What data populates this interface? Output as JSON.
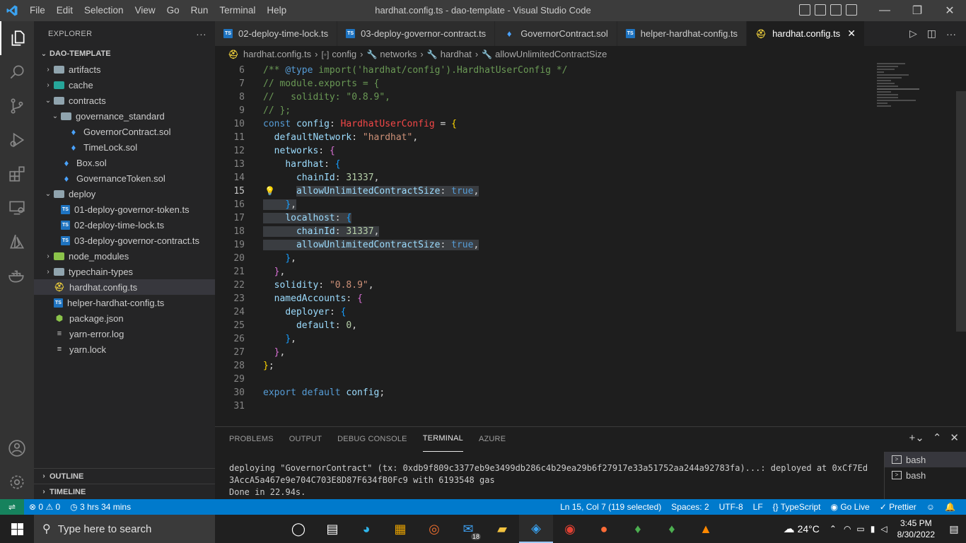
{
  "window": {
    "title": "hardhat.config.ts - dao-template - Visual Studio Code",
    "menu": [
      "File",
      "Edit",
      "Selection",
      "View",
      "Go",
      "Run",
      "Terminal",
      "Help"
    ]
  },
  "sidebar": {
    "header": "EXPLORER",
    "more": "···",
    "root": "DAO-TEMPLATE",
    "tree": [
      {
        "label": "artifacts",
        "kind": "folder",
        "depth": 0,
        "expanded": false
      },
      {
        "label": "cache",
        "kind": "folder-cache",
        "depth": 0,
        "expanded": false
      },
      {
        "label": "contracts",
        "kind": "folder",
        "depth": 0,
        "expanded": true
      },
      {
        "label": "governance_standard",
        "kind": "folder",
        "depth": 1,
        "expanded": true
      },
      {
        "label": "GovernorContract.sol",
        "kind": "sol",
        "depth": 2
      },
      {
        "label": "TimeLock.sol",
        "kind": "sol",
        "depth": 2
      },
      {
        "label": "Box.sol",
        "kind": "sol",
        "depth": 1
      },
      {
        "label": "GovernanceToken.sol",
        "kind": "sol",
        "depth": 1
      },
      {
        "label": "deploy",
        "kind": "folder",
        "depth": 0,
        "expanded": true
      },
      {
        "label": "01-deploy-governor-token.ts",
        "kind": "ts",
        "depth": 1
      },
      {
        "label": "02-deploy-time-lock.ts",
        "kind": "ts",
        "depth": 1
      },
      {
        "label": "03-deploy-governor-contract.ts",
        "kind": "ts",
        "depth": 1
      },
      {
        "label": "node_modules",
        "kind": "folder-node",
        "depth": 0,
        "expanded": false
      },
      {
        "label": "typechain-types",
        "kind": "folder",
        "depth": 0,
        "expanded": false
      },
      {
        "label": "hardhat.config.ts",
        "kind": "hh",
        "depth": 0,
        "selected": true
      },
      {
        "label": "helper-hardhat-config.ts",
        "kind": "ts",
        "depth": 0
      },
      {
        "label": "package.json",
        "kind": "json",
        "depth": 0
      },
      {
        "label": "yarn-error.log",
        "kind": "log",
        "depth": 0
      },
      {
        "label": "yarn.lock",
        "kind": "log",
        "depth": 0
      }
    ],
    "outline": "OUTLINE",
    "timeline": "TIMELINE"
  },
  "tabs": [
    {
      "label": "02-deploy-time-lock.ts",
      "kind": "ts"
    },
    {
      "label": "03-deploy-governor-contract.ts",
      "kind": "ts"
    },
    {
      "label": "GovernorContract.sol",
      "kind": "sol"
    },
    {
      "label": "helper-hardhat-config.ts",
      "kind": "ts"
    },
    {
      "label": "hardhat.config.ts",
      "kind": "hh",
      "active": true
    }
  ],
  "breadcrumb": [
    "hardhat.config.ts",
    "config",
    "networks",
    "hardhat",
    "allowUnlimitedContractSize"
  ],
  "editor": {
    "lines": [
      {
        "n": "6",
        "tokens": [
          [
            "c-com",
            "/** "
          ],
          [
            "c-ann",
            "@type"
          ],
          [
            "c-com",
            " import('hardhat/config').HardhatUserConfig */"
          ]
        ]
      },
      {
        "n": "7",
        "tokens": [
          [
            "c-com",
            "// module.exports = {"
          ]
        ]
      },
      {
        "n": "8",
        "tokens": [
          [
            "c-com",
            "//   solidity: \"0.8.9\","
          ]
        ]
      },
      {
        "n": "9",
        "tokens": [
          [
            "c-com",
            "// };"
          ]
        ]
      },
      {
        "n": "10",
        "tokens": [
          [
            "c-kw",
            "const "
          ],
          [
            "c-var",
            "config"
          ],
          [
            "c-punc",
            ": "
          ],
          [
            "c-type",
            "HardhatUserConfig"
          ],
          [
            "c-punc",
            " = "
          ],
          [
            "c-b1",
            "{"
          ]
        ]
      },
      {
        "n": "11",
        "tokens": [
          [
            "c-punc",
            "  "
          ],
          [
            "c-var",
            "defaultNetwork"
          ],
          [
            "c-punc",
            ": "
          ],
          [
            "c-str",
            "\"hardhat\""
          ],
          [
            "c-punc",
            ","
          ]
        ]
      },
      {
        "n": "12",
        "tokens": [
          [
            "c-punc",
            "  "
          ],
          [
            "c-var",
            "networks"
          ],
          [
            "c-punc",
            ": "
          ],
          [
            "c-b2",
            "{"
          ]
        ]
      },
      {
        "n": "13",
        "tokens": [
          [
            "c-punc",
            "    "
          ],
          [
            "c-var",
            "hardhat"
          ],
          [
            "c-punc",
            ": "
          ],
          [
            "c-b3",
            "{"
          ]
        ]
      },
      {
        "n": "14",
        "tokens": [
          [
            "c-punc",
            "      "
          ],
          [
            "c-var",
            "chainId"
          ],
          [
            "c-punc",
            ": "
          ],
          [
            "c-num",
            "31337"
          ],
          [
            "c-punc",
            ","
          ]
        ]
      },
      {
        "n": "15",
        "tokens": [
          [
            "c-punc",
            "      "
          ],
          [
            "sel c-var",
            "allowUnlimitedContractSize"
          ],
          [
            "sel c-punc",
            ": "
          ],
          [
            "sel c-bool",
            "true"
          ],
          [
            "sel c-punc",
            ","
          ]
        ],
        "current": true,
        "bulb": true
      },
      {
        "n": "16",
        "tokens": [
          [
            "sel c-punc",
            "    "
          ],
          [
            "sel c-b3",
            "}"
          ],
          [
            "sel c-punc",
            ","
          ]
        ]
      },
      {
        "n": "17",
        "tokens": [
          [
            "sel c-punc",
            "    "
          ],
          [
            "sel c-var",
            "localhost"
          ],
          [
            "sel c-punc",
            ": "
          ],
          [
            "sel c-b3",
            "{"
          ]
        ]
      },
      {
        "n": "18",
        "tokens": [
          [
            "sel c-punc",
            "      "
          ],
          [
            "sel c-var",
            "chainId"
          ],
          [
            "sel c-punc",
            ": "
          ],
          [
            "sel c-num",
            "31337"
          ],
          [
            "sel c-punc",
            ","
          ]
        ]
      },
      {
        "n": "19",
        "tokens": [
          [
            "sel c-punc",
            "      "
          ],
          [
            "sel c-var",
            "allowUnlimitedContractSize"
          ],
          [
            "sel c-punc",
            ": "
          ],
          [
            "sel c-bool",
            "true"
          ],
          [
            "sel c-punc",
            ","
          ]
        ]
      },
      {
        "n": "20",
        "tokens": [
          [
            "c-punc",
            "    "
          ],
          [
            "c-b3",
            "}"
          ],
          [
            "c-punc",
            ","
          ]
        ]
      },
      {
        "n": "21",
        "tokens": [
          [
            "c-punc",
            "  "
          ],
          [
            "c-b2",
            "}"
          ],
          [
            "c-punc",
            ","
          ]
        ]
      },
      {
        "n": "22",
        "tokens": [
          [
            "c-punc",
            "  "
          ],
          [
            "c-var",
            "solidity"
          ],
          [
            "c-punc",
            ": "
          ],
          [
            "c-str",
            "\"0.8.9\""
          ],
          [
            "c-punc",
            ","
          ]
        ]
      },
      {
        "n": "23",
        "tokens": [
          [
            "c-punc",
            "  "
          ],
          [
            "c-var",
            "namedAccounts"
          ],
          [
            "c-punc",
            ": "
          ],
          [
            "c-b2",
            "{"
          ]
        ]
      },
      {
        "n": "24",
        "tokens": [
          [
            "c-punc",
            "    "
          ],
          [
            "c-var",
            "deployer"
          ],
          [
            "c-punc",
            ": "
          ],
          [
            "c-b3",
            "{"
          ]
        ]
      },
      {
        "n": "25",
        "tokens": [
          [
            "c-punc",
            "      "
          ],
          [
            "c-var",
            "default"
          ],
          [
            "c-punc",
            ": "
          ],
          [
            "c-num",
            "0"
          ],
          [
            "c-punc",
            ","
          ]
        ]
      },
      {
        "n": "26",
        "tokens": [
          [
            "c-punc",
            "    "
          ],
          [
            "c-b3",
            "}"
          ],
          [
            "c-punc",
            ","
          ]
        ]
      },
      {
        "n": "27",
        "tokens": [
          [
            "c-punc",
            "  "
          ],
          [
            "c-b2",
            "}"
          ],
          [
            "c-punc",
            ","
          ]
        ]
      },
      {
        "n": "28",
        "tokens": [
          [
            "c-b1",
            "}"
          ],
          [
            "c-punc",
            ";"
          ]
        ]
      },
      {
        "n": "29",
        "tokens": []
      },
      {
        "n": "30",
        "tokens": [
          [
            "c-kw",
            "export default "
          ],
          [
            "c-var",
            "config"
          ],
          [
            "c-punc",
            ";"
          ]
        ]
      },
      {
        "n": "31",
        "tokens": []
      }
    ]
  },
  "panel": {
    "tabs": [
      "PROBLEMS",
      "OUTPUT",
      "DEBUG CONSOLE",
      "TERMINAL",
      "AZURE"
    ],
    "active_tab": "TERMINAL",
    "terminal_lines": [
      "deploying \"GovernorContract\" (tx: 0xdb9f809c3377eb9e3499db286c4b29ea29b6f27917e33a51752aa244a92783fa)...: deployed at 0xCf7Ed3AccA5a467e9e704C703E8D87F634fB0Fc9 with 6193548 gas",
      "Done in 22.94s."
    ],
    "shells": [
      "bash",
      "bash"
    ]
  },
  "statusbar": {
    "errors": "0",
    "warnings": "0",
    "time_tracker": "3 hrs 34 mins",
    "position": "Ln 15, Col 7 (119 selected)",
    "spaces": "Spaces: 2",
    "encoding": "UTF-8",
    "eol": "LF",
    "language": "TypeScript",
    "golive": "Go Live",
    "prettier": "Prettier"
  },
  "taskbar": {
    "search_placeholder": "Type here to search",
    "temperature": "24°C",
    "time": "3:45 PM",
    "date": "8/30/2022",
    "mail_badge": "18"
  },
  "colors": {
    "accent": "#007acc",
    "titlebar": "#3c3c3c",
    "activitybar": "#333333",
    "sidebar": "#252526",
    "editor": "#1e1e1e"
  }
}
